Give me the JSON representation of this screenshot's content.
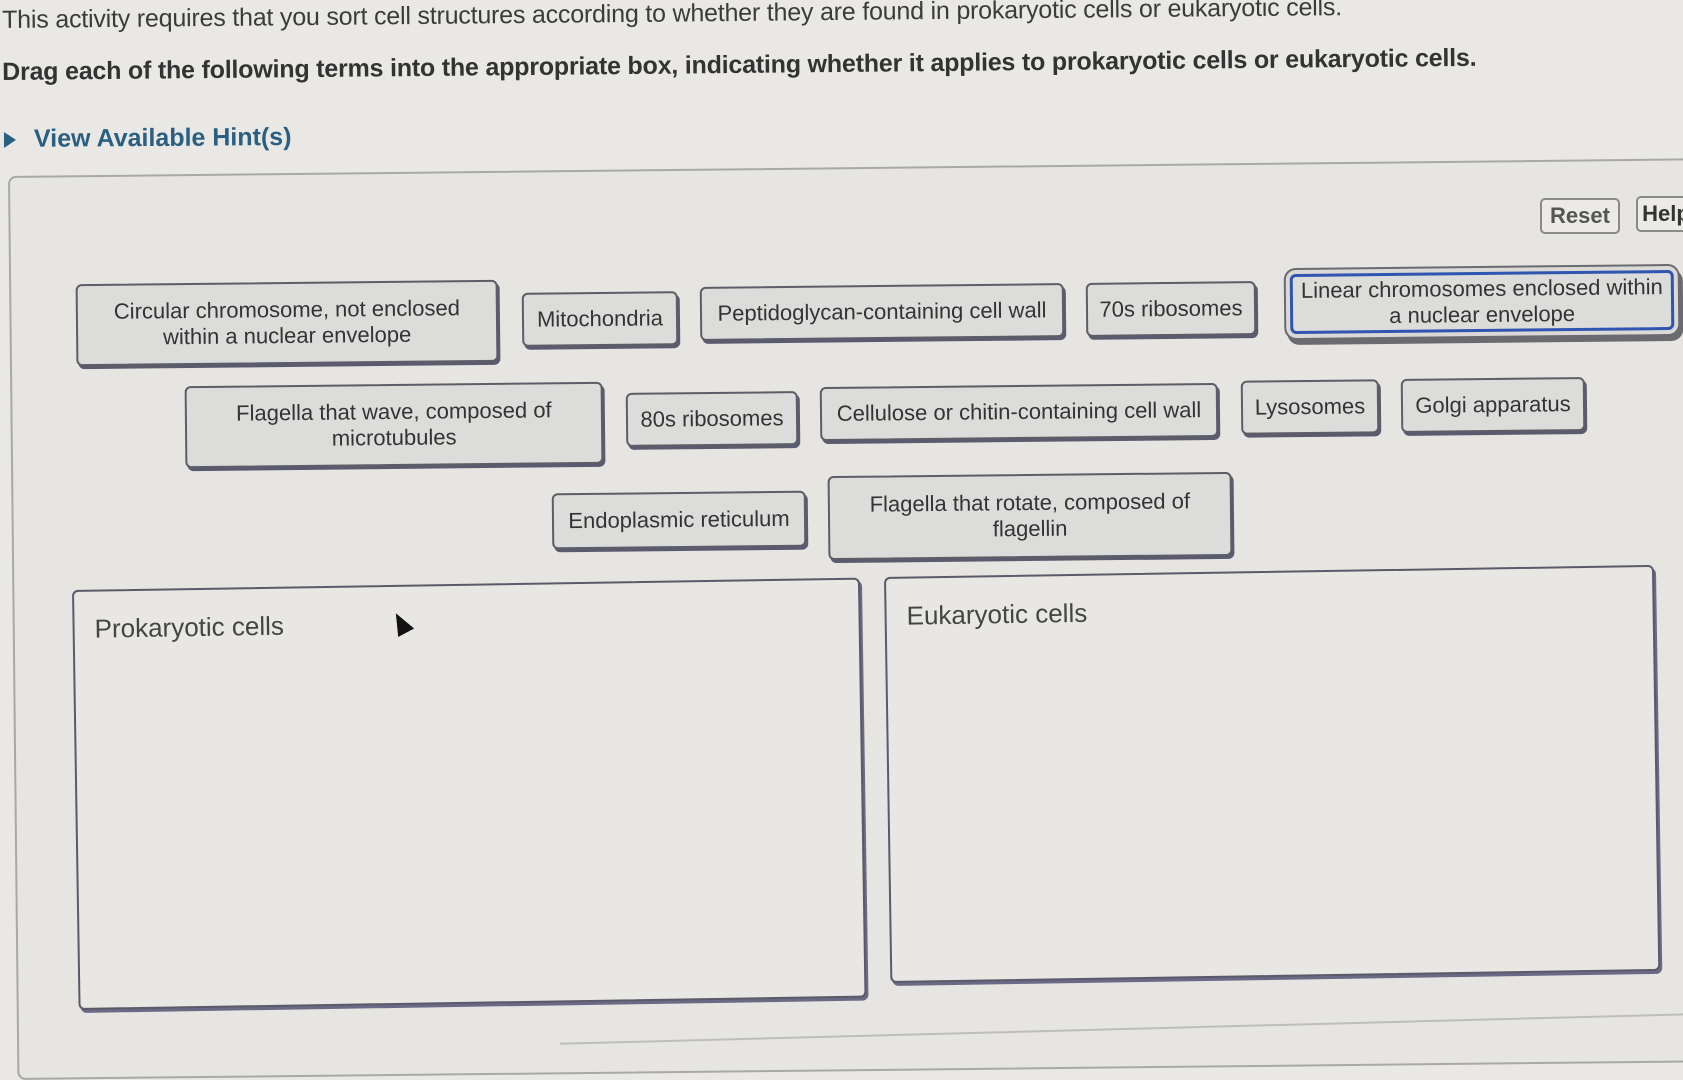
{
  "intro_text": "This activity requires that you sort cell structures according to whether they are found in prokaryotic cells or eukaryotic cells.",
  "instruction_text": "Drag each of the following terms into the appropriate box, indicating whether it applies to prokaryotic cells or eukaryotic cells.",
  "hint": {
    "label": "View Available Hint(s)",
    "icon": "triangle-right-icon",
    "color": "#2b5f82"
  },
  "toolbar": {
    "reset_label": "Reset",
    "help_label": "Help"
  },
  "terms": [
    {
      "label": "Circular chromosome, not enclosed within a nuclear envelope",
      "selected": false
    },
    {
      "label": "Mitochondria",
      "selected": false
    },
    {
      "label": "Peptidoglycan-containing cell wall",
      "selected": false
    },
    {
      "label": "70s ribosomes",
      "selected": false
    },
    {
      "label": "Linear chromosomes enclosed within a nuclear envelope",
      "selected": true
    },
    {
      "label": "Flagella that wave, composed of microtubules",
      "selected": false
    },
    {
      "label": "80s ribosomes",
      "selected": false
    },
    {
      "label": "Cellulose or chitin-containing cell wall",
      "selected": false
    },
    {
      "label": "Lysosomes",
      "selected": false
    },
    {
      "label": "Golgi apparatus",
      "selected": false
    },
    {
      "label": "Endoplasmic reticulum",
      "selected": false
    },
    {
      "label": "Flagella that rotate, composed of flagellin",
      "selected": false
    }
  ],
  "dropzones": {
    "prokaryotic": {
      "title": "Prokaryotic cells",
      "items": []
    },
    "eukaryotic": {
      "title": "Eukaryotic cells",
      "items": []
    }
  },
  "colors": {
    "selected_border": "#2f55b0",
    "tile_background": "#dcdcda",
    "page_background": "#e9e8e4"
  }
}
